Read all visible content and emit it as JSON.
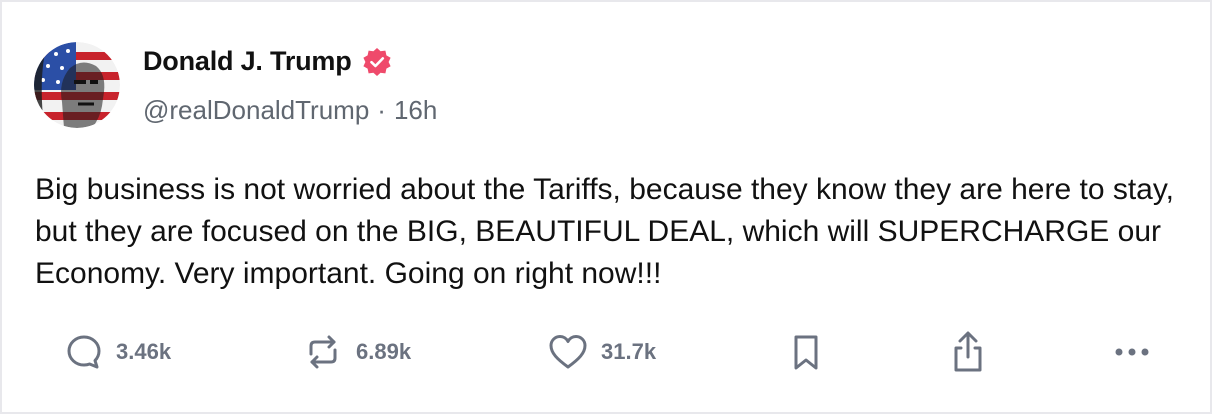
{
  "author": {
    "display_name": "Donald J. Trump",
    "handle": "@realDonaldTrump",
    "separator": "·",
    "time_ago": "16h",
    "verified": true,
    "verified_color": "#ef4a6b"
  },
  "post": {
    "text": "Big business is not worried about the Tariffs, because they know they are here to stay, but they are focused on the BIG, BEAUTIFUL DEAL, which will SUPERCHARGE our Economy. Very important. Going on right now!!!"
  },
  "actions": {
    "replies": {
      "icon": "reply-icon",
      "count": "3.46k"
    },
    "reposts": {
      "icon": "repost-icon",
      "count": "6.89k"
    },
    "likes": {
      "icon": "heart-icon",
      "count": "31.7k"
    },
    "bookmark": {
      "icon": "bookmark-icon"
    },
    "share": {
      "icon": "share-icon"
    },
    "more": {
      "icon": "more-icon"
    }
  },
  "colors": {
    "text": "#111111",
    "muted": "#606770",
    "icon": "#6b7280",
    "border": "#e8e8ec"
  }
}
